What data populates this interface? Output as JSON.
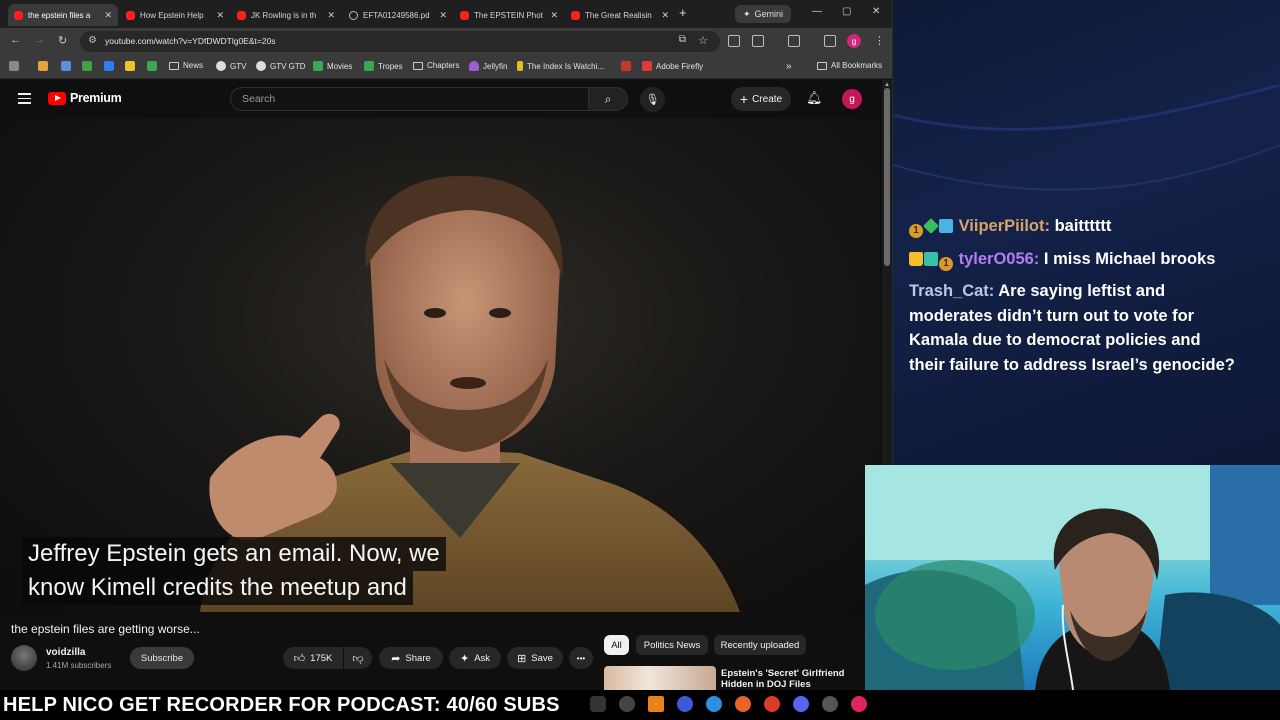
{
  "browser": {
    "tabs": [
      {
        "title": "the epstein files a",
        "favicon": "youtube-icon",
        "active": true
      },
      {
        "title": "How Epstein Help",
        "favicon": "youtube-icon",
        "active": false
      },
      {
        "title": "JK Rowling is in th",
        "favicon": "youtube-icon",
        "active": false
      },
      {
        "title": "EFTA01249586.pd",
        "favicon": "globe-icon",
        "active": false
      },
      {
        "title": "The EPSTEIN Phot",
        "favicon": "youtube-icon",
        "active": false
      },
      {
        "title": "The Great Realisin",
        "favicon": "youtube-icon",
        "active": false
      }
    ],
    "new_tab": "+",
    "gemini_label": "Gemini",
    "url": "youtube.com/watch?v=YDfDWDTlg0E&t=20s",
    "profile_initial": "g",
    "bookmarks": [
      "News",
      "GTV",
      "GTV GTD",
      "Movies",
      "Tropes",
      "Chapters",
      "Jellyfin",
      "The Index Is Watchi...",
      "Adobe Firefly"
    ],
    "all_bookmarks": "All Bookmarks"
  },
  "youtube": {
    "logo_text": "Premium",
    "search_placeholder": "Search",
    "create_label": "Create",
    "avatar_initial": "g",
    "caption_line1": "Jeffrey Epstein gets an email. Now, we",
    "caption_line2": "know Kimell credits the meetup and",
    "video_title": "the epstein files are getting worse...",
    "channel_name": "voidzilla",
    "channel_subs": "1.41M subscribers",
    "subscribe_label": "Subscribe",
    "like_count": "175K",
    "share_label": "Share",
    "ask_label": "Ask",
    "save_label": "Save",
    "more_label": "•••",
    "chips": [
      "All",
      "Politics News",
      "Recently uploaded"
    ],
    "rec_title": "Epstein's 'Secret' Girlfriend Hidden in DOJ Files"
  },
  "chat": {
    "messages": [
      {
        "user": "ViiperPiilot:",
        "text": " baitttttt",
        "user_color": "#d6a36a"
      },
      {
        "user": "tylerO056:",
        "text": " I miss Michael brooks",
        "user_color": "#b67cf5"
      },
      {
        "user": "Trash_Cat:",
        "text": " Are saying leftist and moderates didn’t turn out to vote for Kamala due to democrat policies and their failure to address Israel’s genocide?",
        "user_color": "#b9c6e6"
      }
    ]
  },
  "ticker": {
    "text": "HELP NICO GET RECORDER FOR PODCAST: 40/60 SUBS"
  }
}
